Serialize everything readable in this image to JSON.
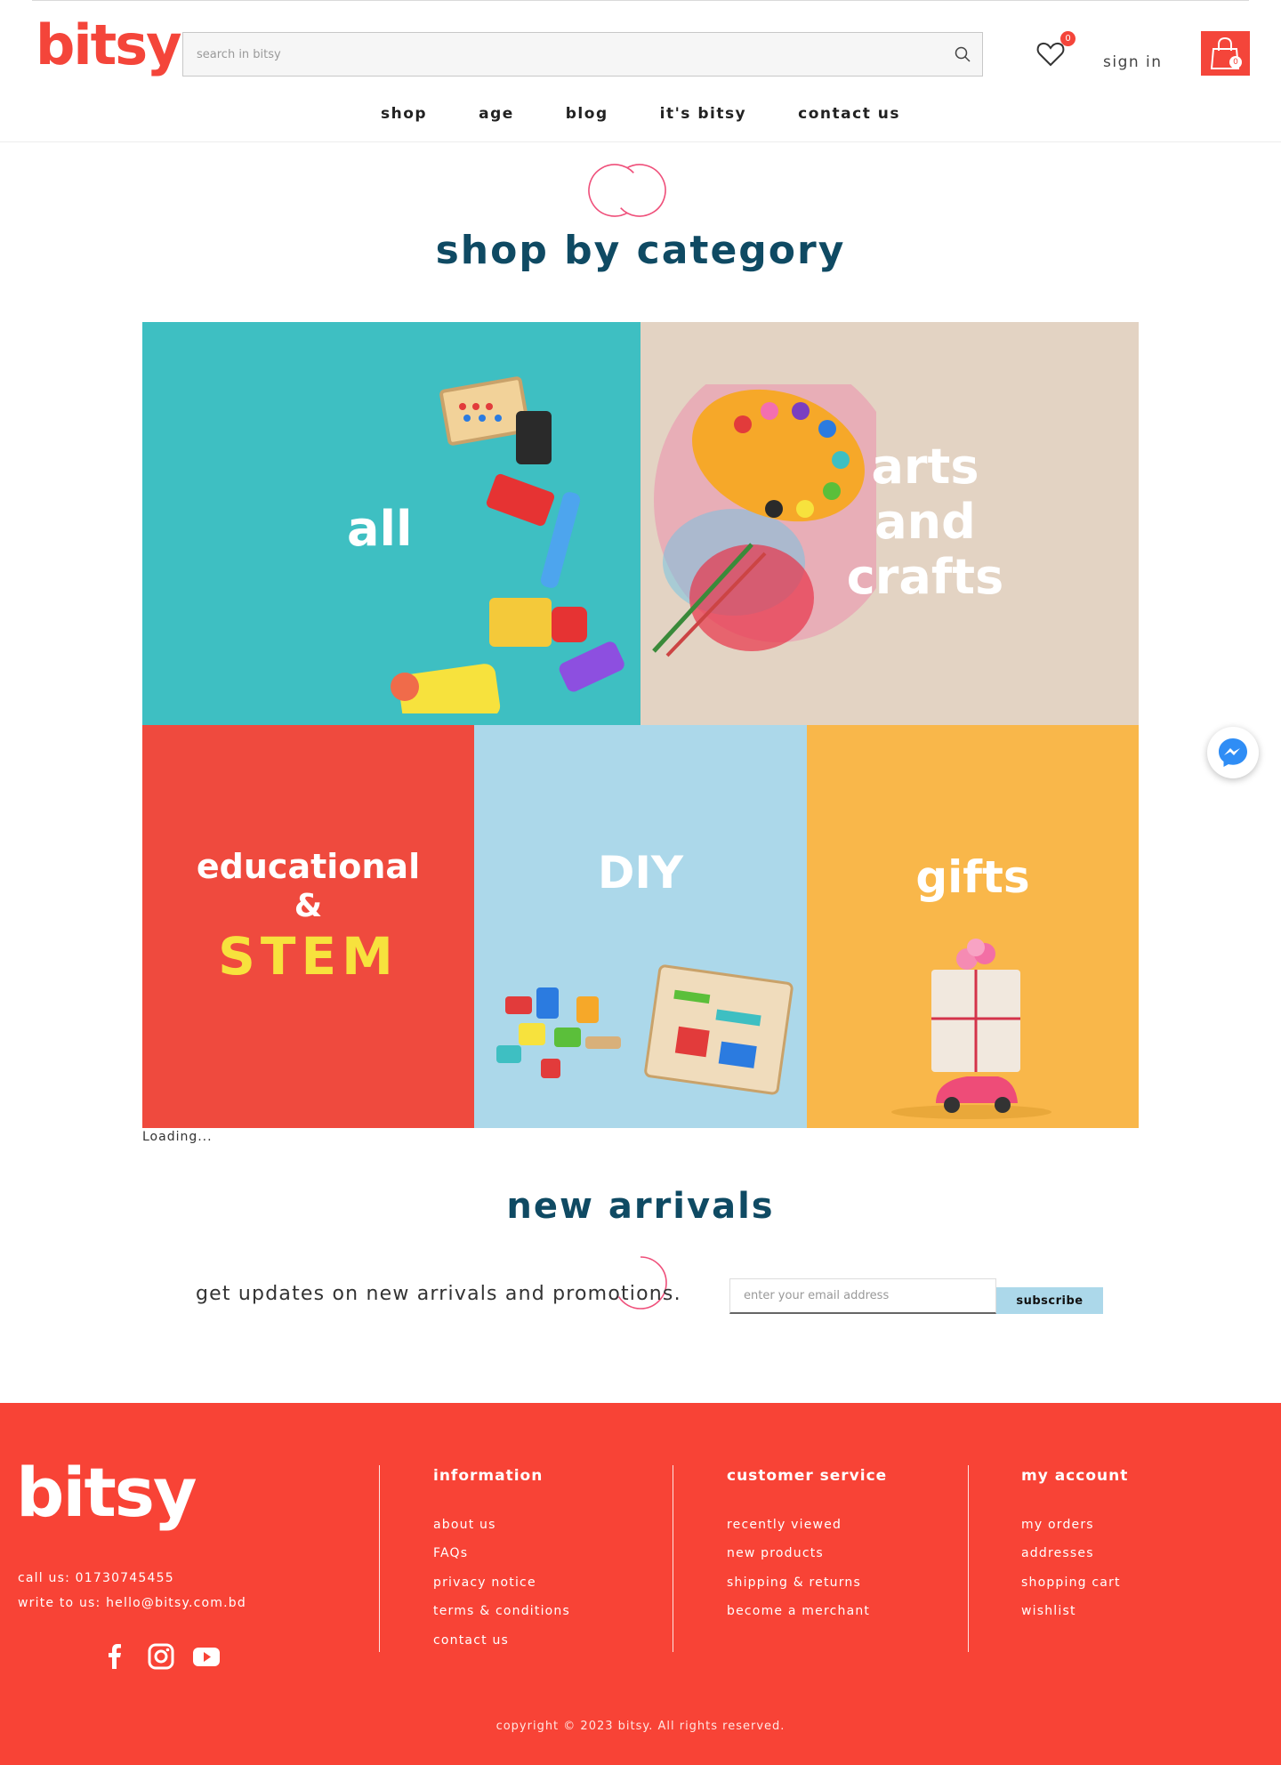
{
  "header": {
    "logo": "bitsy",
    "search_placeholder": "search in bitsy",
    "wishlist_count": "0",
    "sign_in": "sign in",
    "cart_count": "0"
  },
  "nav": [
    "shop",
    "age",
    "blog",
    "it's bitsy",
    "contact us"
  ],
  "categories": {
    "title": "shop by category",
    "tiles": [
      {
        "label": "all",
        "color": "#3ebfc2"
      },
      {
        "label": "arts and crafts",
        "line1": "arts",
        "line2": "and",
        "line3": "crafts",
        "color": "#e3d3c3"
      },
      {
        "label": "educational & STEM",
        "line1": "educational",
        "line2": "&",
        "line3": "STEM",
        "color": "#ef4a3e"
      },
      {
        "label": "DIY",
        "color": "#acd8ea"
      },
      {
        "label": "gifts",
        "color": "#f9b74a"
      }
    ],
    "loading": "Loading..."
  },
  "new_arrivals": {
    "title": "new arrivals"
  },
  "newsletter": {
    "text": "get updates on new arrivals and promotions.",
    "email_placeholder": "enter your email address",
    "button": "subscribe"
  },
  "footer": {
    "logo": "bitsy",
    "call": "call us: 01730745455",
    "write": "write to us: hello@bitsy.com.bd",
    "social": [
      "facebook-icon",
      "instagram-icon",
      "youtube-icon"
    ],
    "columns": [
      {
        "title": "information",
        "links": [
          "about us",
          "FAQs",
          "privacy notice",
          "terms & conditions",
          "contact us"
        ]
      },
      {
        "title": "customer service",
        "links": [
          "recently viewed",
          "new products",
          "shipping & returns",
          "become a merchant"
        ]
      },
      {
        "title": "my account",
        "links": [
          "my orders",
          "addresses",
          "shopping cart",
          "wishlist"
        ]
      }
    ],
    "copyright": "copyright © 2023 bitsy. All rights reserved."
  },
  "colors": {
    "brand_red": "#f4453a",
    "heading_navy": "#0f4a63",
    "subscribe_blue": "#acd8ea"
  }
}
